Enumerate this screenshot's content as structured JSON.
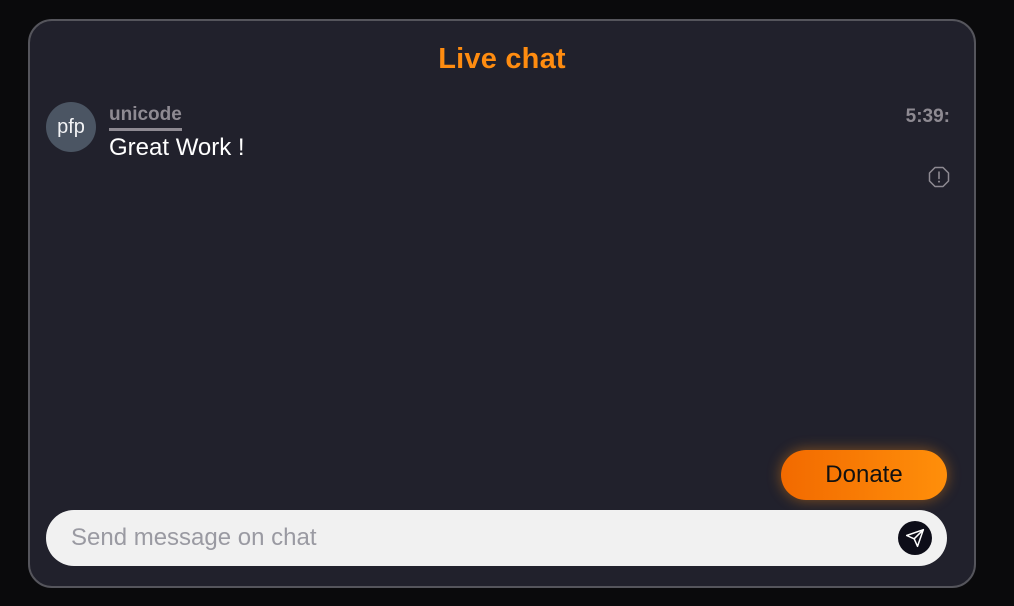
{
  "chat": {
    "title": "Live chat",
    "input_placeholder": "Send message on chat",
    "donate_label": "Donate",
    "messages": [
      {
        "avatar_text": "pfp",
        "username": "unicode",
        "text": "Great Work !",
        "time": "5:39:"
      }
    ]
  },
  "icons": {
    "report": "report-icon",
    "send": "send-icon"
  },
  "colors": {
    "page_background": "#0a0a0c",
    "panel_background": "#21212c",
    "panel_border": "#55555c",
    "accent": "#ff8c10",
    "username": "#8e8a92",
    "avatar": "#4b5563",
    "input_background": "#f1f1f1",
    "send_button": "#0d0d18"
  }
}
